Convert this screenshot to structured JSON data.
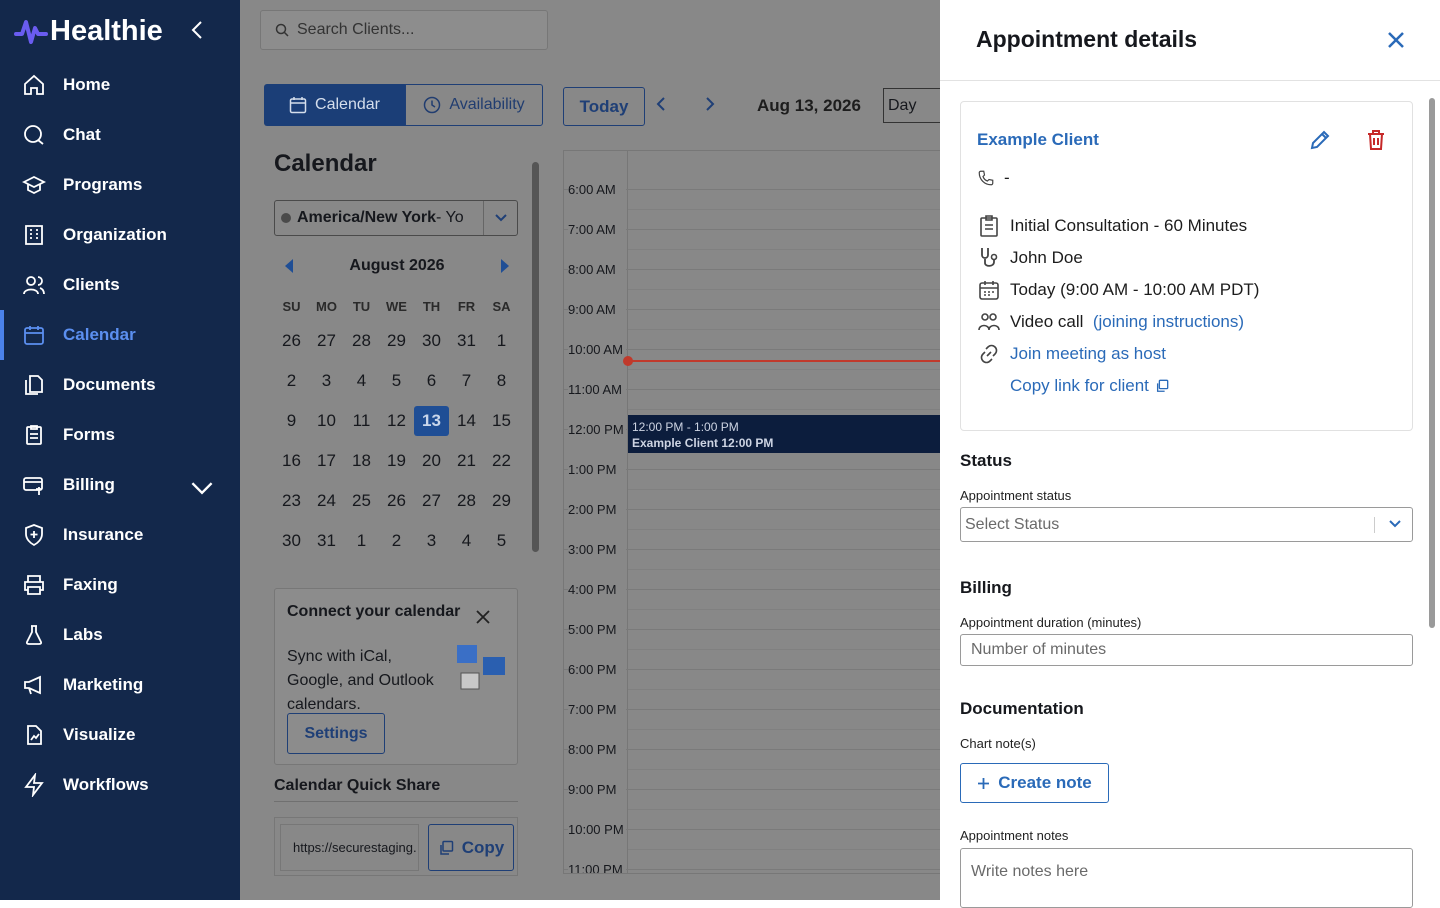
{
  "brand": {
    "name": "Healthie",
    "accent": "#13284b",
    "link_color": "#2a6ab8"
  },
  "sidebar": {
    "items": [
      {
        "label": "Home",
        "icon": "home-icon"
      },
      {
        "label": "Chat",
        "icon": "chat-icon"
      },
      {
        "label": "Programs",
        "icon": "graduation-cap-icon"
      },
      {
        "label": "Organization",
        "icon": "building-icon"
      },
      {
        "label": "Clients",
        "icon": "users-icon"
      },
      {
        "label": "Calendar",
        "icon": "calendar-icon"
      },
      {
        "label": "Documents",
        "icon": "documents-icon"
      },
      {
        "label": "Forms",
        "icon": "clipboard-icon"
      },
      {
        "label": "Billing",
        "icon": "billing-icon"
      },
      {
        "label": "Insurance",
        "icon": "shield-plus-icon"
      },
      {
        "label": "Faxing",
        "icon": "printer-icon"
      },
      {
        "label": "Labs",
        "icon": "flask-icon"
      },
      {
        "label": "Marketing",
        "icon": "megaphone-icon"
      },
      {
        "label": "Visualize",
        "icon": "chart-file-icon"
      },
      {
        "label": "Workflows",
        "icon": "lightning-icon"
      }
    ],
    "active": "Calendar"
  },
  "search": {
    "placeholder": "Search Clients..."
  },
  "toolbar": {
    "calendar_tab": "Calendar",
    "availability_tab": "Availability",
    "today": "Today",
    "date": "Aug 13, 2026",
    "view": "Day"
  },
  "left": {
    "title": "Calendar",
    "timezone_strong": "America/New York",
    "timezone_rest": " - Yo",
    "month": "August 2026",
    "weekdays": [
      "SU",
      "MO",
      "TU",
      "WE",
      "TH",
      "FR",
      "SA"
    ],
    "days": [
      [
        "26",
        "27",
        "28",
        "29",
        "30",
        "31",
        "1"
      ],
      [
        "2",
        "3",
        "4",
        "5",
        "6",
        "7",
        "8"
      ],
      [
        "9",
        "10",
        "11",
        "12",
        "13",
        "14",
        "15"
      ],
      [
        "16",
        "17",
        "18",
        "19",
        "20",
        "21",
        "22"
      ],
      [
        "23",
        "24",
        "25",
        "26",
        "27",
        "28",
        "29"
      ],
      [
        "30",
        "31",
        "1",
        "2",
        "3",
        "4",
        "5"
      ]
    ],
    "selected_day": "13",
    "connect_title": "Connect your calendar",
    "connect_body": "Sync with iCal, Google, and Outlook calendars.",
    "settings": "Settings",
    "quick_share": "Calendar Quick Share",
    "share_url": "https://securestaging.",
    "copy": "Copy"
  },
  "timeline": {
    "slots": [
      "6:00 AM",
      "7:00 AM",
      "8:00 AM",
      "9:00 AM",
      "10:00 AM",
      "11:00 AM",
      "12:00 PM",
      "1:00 PM",
      "2:00 PM",
      "3:00 PM",
      "4:00 PM",
      "5:00 PM",
      "6:00 PM",
      "7:00 PM",
      "8:00 PM",
      "9:00 PM",
      "10:00 PM",
      "11:00 PM"
    ],
    "event_time": "12:00 PM - 1:00 PM",
    "event_title": "Example Client 12:00 PM"
  },
  "panel": {
    "title": "Appointment details",
    "client": "Example Client",
    "phone": "-",
    "appointment_type": "Initial Consultation - 60 Minutes",
    "provider": "John Doe",
    "when": "Today (9:00 AM - 10:00 AM PDT)",
    "call_type": "Video call",
    "joining": "(joining instructions)",
    "join_host": "Join meeting as host",
    "copy_link": "Copy link for client",
    "status_heading": "Status",
    "status_label": "Appointment status",
    "status_placeholder": "Select Status",
    "billing_heading": "Billing",
    "duration_label": "Appointment duration (minutes)",
    "duration_placeholder": "Number of minutes",
    "doc_heading": "Documentation",
    "chart_notes_label": "Chart note(s)",
    "create_note": "Create note",
    "notes_label": "Appointment notes",
    "notes_placeholder": "Write notes here"
  }
}
